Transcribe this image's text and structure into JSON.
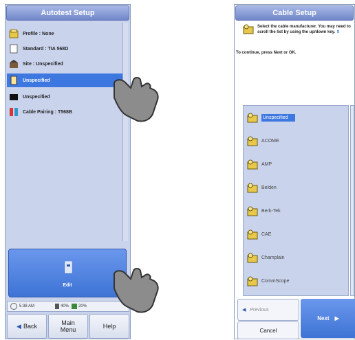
{
  "left_panel": {
    "title": "Autotest Setup",
    "items": [
      {
        "label": "Profile : None",
        "icon": "profile-icon",
        "selected": false
      },
      {
        "label": "Standard : TIA 568D",
        "icon": "document-icon",
        "selected": false
      },
      {
        "label": "Site : Unspecified",
        "icon": "site-icon",
        "selected": false
      },
      {
        "label": "Unspecified",
        "icon": "cable-icon",
        "selected": true
      },
      {
        "label": "Unspecified",
        "icon": "black-box-icon",
        "selected": false
      },
      {
        "label": "Cable Pairing : T568B",
        "icon": "pairing-icon",
        "selected": false
      }
    ],
    "edit_label": "Edit",
    "status": {
      "time": "5:38 AM",
      "battery1": "40%",
      "battery2": "20%"
    },
    "buttons": {
      "back": "Back",
      "main_menu": "Main Menu",
      "help": "Help"
    }
  },
  "right_panel": {
    "title": "Cable Setup",
    "instruction": "Select the cable manufacturer. You may need to scroll the list by using the up/down key.",
    "continue_text": "To continue, press Next or OK.",
    "manufacturers": [
      {
        "label": "Unspecified",
        "selected": true
      },
      {
        "label": "ACOME",
        "selected": false
      },
      {
        "label": "AMP",
        "selected": false
      },
      {
        "label": "Belden",
        "selected": false
      },
      {
        "label": "Berk-Tek",
        "selected": false
      },
      {
        "label": "CAE",
        "selected": false
      },
      {
        "label": "Champlain",
        "selected": false
      },
      {
        "label": "CommScope",
        "selected": false
      }
    ],
    "buttons": {
      "previous": "Previous",
      "cancel": "Cancel",
      "next": "Next"
    }
  },
  "colors": {
    "accent": "#3d77e0",
    "panel": "#c9d3ec"
  }
}
